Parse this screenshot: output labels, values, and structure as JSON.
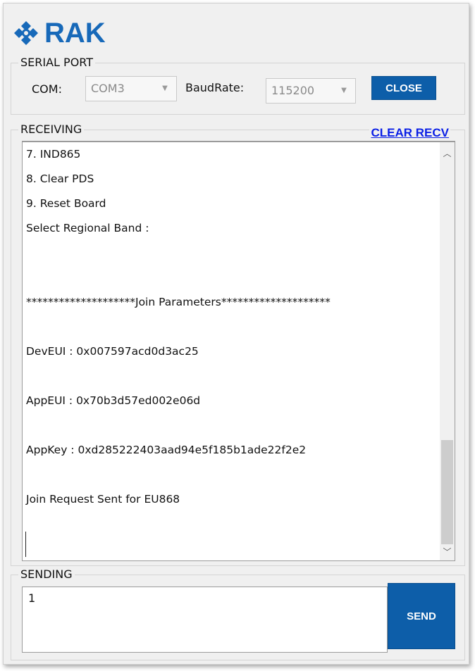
{
  "brand": {
    "name": "RAK"
  },
  "serial_port": {
    "title": "SERIAL PORT",
    "com_label": "COM:",
    "com_value": "COM3",
    "baud_label": "BaudRate:",
    "baud_value": "115200",
    "close_label": "CLOSE"
  },
  "receiving": {
    "title": "RECEIVING",
    "clear_label": "CLEAR RECV",
    "lines": [
      "7. IND865",
      "8. Clear PDS",
      "9. Reset Board",
      "Select Regional Band :",
      "",
      "",
      "********************Join Parameters********************",
      "",
      "DevEUI : 0x007597acd0d3ac25",
      "",
      "AppEUI : 0x70b3d57ed002e06d",
      "",
      "AppKey : 0xd285222403aad94e5f185b1ade22f2e2",
      "",
      "Join Request Sent for EU868"
    ],
    "scroll_thumb_fraction": 0.27
  },
  "sending": {
    "title": "SENDING",
    "input_value": "1",
    "send_label": "SEND"
  },
  "colors": {
    "accent": "#0d5ea9",
    "link": "#0a1fe6",
    "brand": "#1769b9"
  },
  "icons": {
    "logo": "rak-logo-icon",
    "scroll_up": "chevron-up-icon",
    "scroll_down": "chevron-down-icon",
    "dropdown": "dropdown-arrow-icon"
  }
}
